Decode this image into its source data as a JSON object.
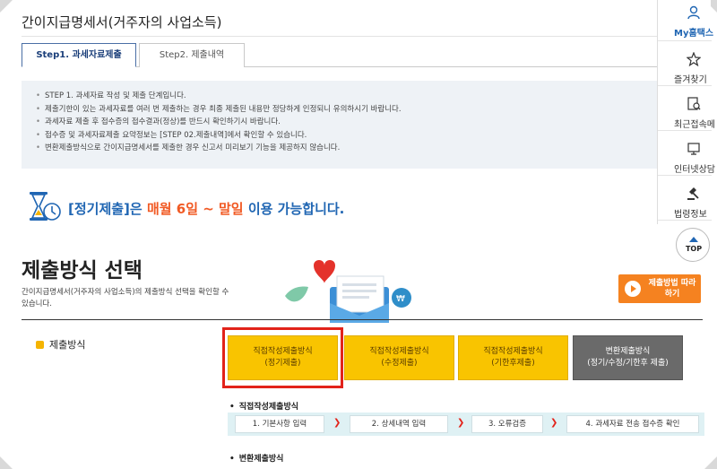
{
  "page": {
    "title": "간이지급명세서(거주자의 사업소득)"
  },
  "tabs": [
    {
      "label": "Step1. 과세자료제출",
      "active": true
    },
    {
      "label": "Step2. 제출내역",
      "active": false
    }
  ],
  "notice": {
    "items": [
      "STEP 1. 과세자료 작성 및 제출 단계입니다.",
      "제출기한이 있는 과세자료를 여러 번 제출하는 경우 최종 제출된 내용만 정당하게 인정되니 유의하시기 바랍니다.",
      "과세자료 제출 후 접수증의 접수결과(정상)를 반드시 확인하기시 바랍니다.",
      "접수증 및 과세자료제출 요약정보는 [STEP 02.제출내역]에서 확인할 수 있습니다.",
      "변환제출방식으로 간이지급명세서를 제출한 경우 신고서 미리보기 기능을 제공하지 않습니다."
    ]
  },
  "period": {
    "prefix": "[정기제출]은 ",
    "highlight": "매월 6일 ~ 말일",
    "suffix": " 이용 가능합니다."
  },
  "method": {
    "title": "제출방식 선택",
    "description": "간이지급명세서(거주자의 사업소득)의 제출방식 선택을 확인할 수 있습니다.",
    "video_label": "제출방법 따라하기",
    "sub_label": "제출방식",
    "options": [
      {
        "line1": "직접작성제출방식",
        "line2": "(정기제출)",
        "selected": true
      },
      {
        "line1": "직접작성제출방식",
        "line2": "(수정제출)",
        "selected": false
      },
      {
        "line1": "직접작성제출방식",
        "line2": "(기한후제출)",
        "selected": false
      },
      {
        "line1": "변환제출방식",
        "line2": "(정기/수정/기한후 제출)",
        "selected": false
      }
    ]
  },
  "flow": {
    "title": "직접작성제출방식",
    "steps": [
      "1. 기본사항 입력",
      "2. 상세내역 입력",
      "3. 오류검증",
      "4. 과세자료 전송 접수증 확인"
    ],
    "next_title": "변환제출방식"
  },
  "quick_menu": {
    "items": [
      {
        "label": "My홈택스",
        "icon": "user-icon"
      },
      {
        "label": "즐겨찾기",
        "icon": "star-icon"
      },
      {
        "label": "최근접속메",
        "icon": "recent-icon"
      },
      {
        "label": "인터넷상담",
        "icon": "monitor-icon"
      },
      {
        "label": "법령정보",
        "icon": "gavel-icon"
      }
    ],
    "top_label": "TOP"
  },
  "colors": {
    "accent_blue": "#2066b3",
    "highlight_orange": "#f15a24",
    "option_yellow": "#f9c400",
    "selection_red": "#e2231a"
  }
}
